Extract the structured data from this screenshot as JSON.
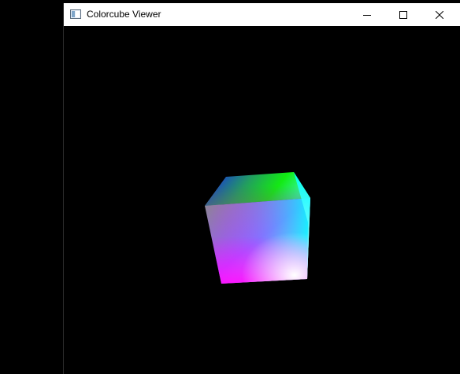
{
  "window": {
    "title": "Colorcube Viewer",
    "app_icon": "window-app-icon",
    "controls": {
      "minimize_icon": "minimize-icon",
      "maximize_icon": "maximize-icon",
      "close_icon": "close-icon"
    }
  },
  "viewport": {
    "background": "#000000",
    "object": "rgb-color-cube",
    "face_colors": {
      "top_left": "#1a1aff",
      "top_right": "#1aff1a",
      "right": "#00ffff",
      "bottom_left": "#ff00ff",
      "bottom_right": "#ffffff",
      "left_edge": "#808080"
    }
  }
}
